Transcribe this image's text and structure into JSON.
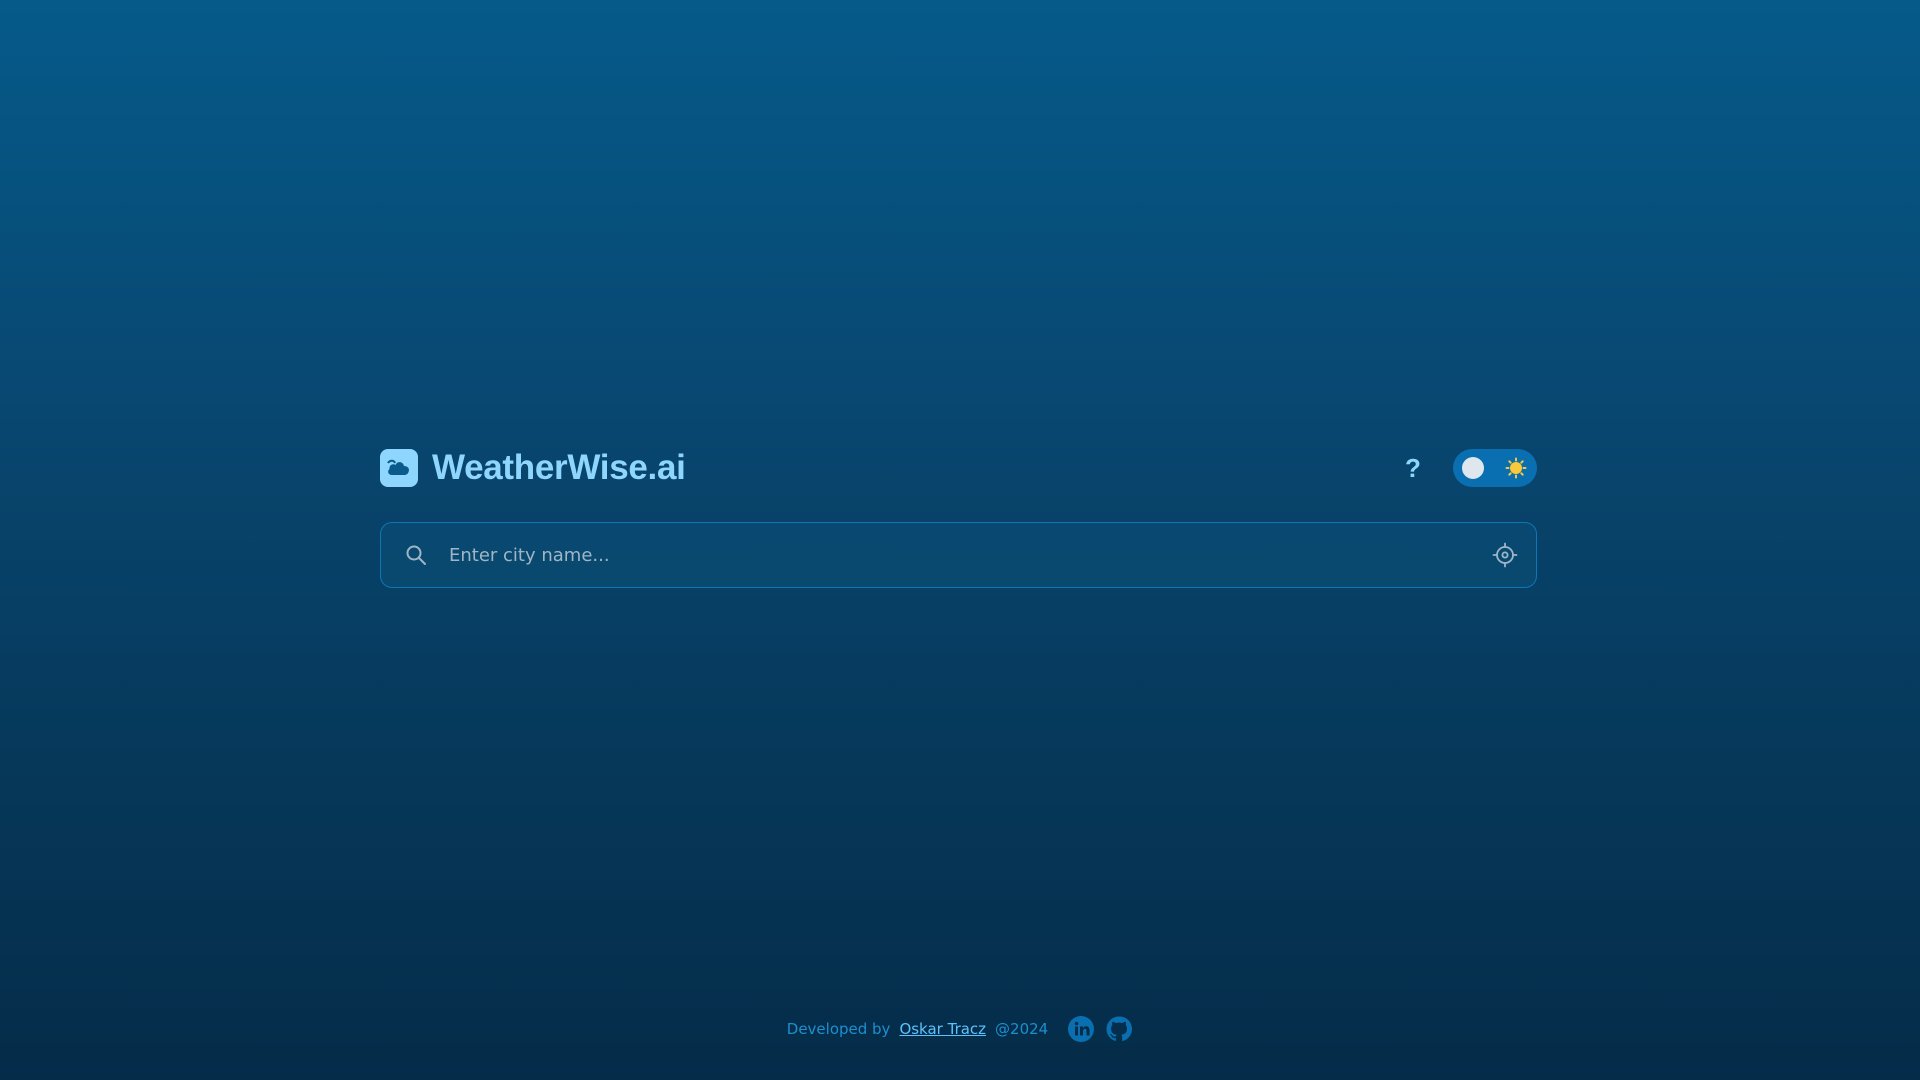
{
  "header": {
    "brand_name": "WeatherWise.ai",
    "help_label": "?"
  },
  "search": {
    "placeholder": "Enter city name...",
    "value": ""
  },
  "footer": {
    "developed_by": "Developed by",
    "author": "Oskar Tracz",
    "year": "@2024"
  },
  "icons": {
    "logo": "cloud-icon",
    "theme_sun": "sun-icon",
    "search": "search-icon",
    "locate": "crosshair-icon",
    "linkedin": "linkedin-icon",
    "github": "github-icon"
  },
  "colors": {
    "accent": "#8fd6ff",
    "toggle_bg": "#0a6fb0",
    "sun": "#f7c93b",
    "footer_text": "#1c8fd0",
    "link": "#5cc2ff"
  }
}
